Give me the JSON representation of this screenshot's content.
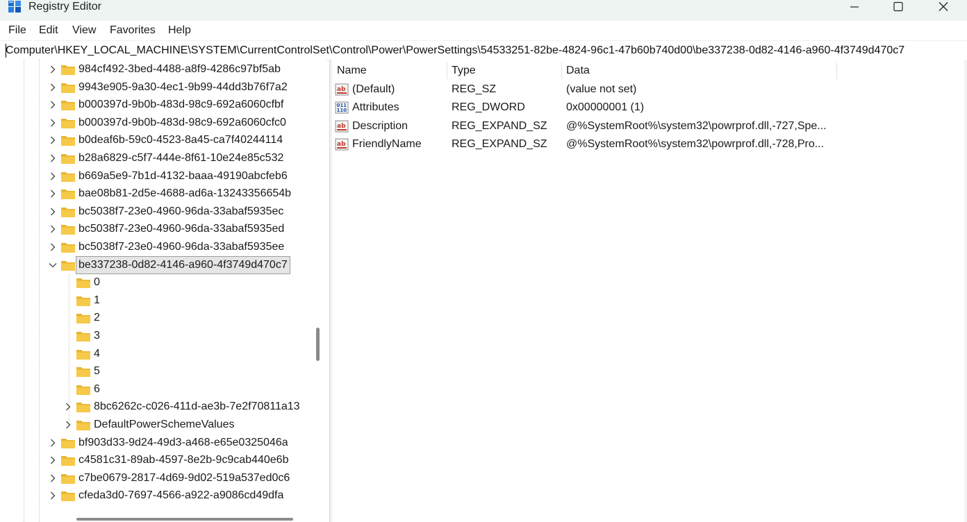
{
  "window": {
    "title": "Registry Editor"
  },
  "menu": [
    "File",
    "Edit",
    "View",
    "Favorites",
    "Help"
  ],
  "address": {
    "path": "Computer\\HKEY_LOCAL_MACHINE\\SYSTEM\\CurrentControlSet\\Control\\Power\\PowerSettings\\54533251-82be-4824-96c1-47b60b740d00\\be337238-0d82-4146-a960-4f3749d470c7"
  },
  "tree": {
    "items": [
      {
        "label": "984cf492-3bed-4488-a8f9-4286c97bf5ab",
        "level": 1,
        "arrow": "collapsed"
      },
      {
        "label": "9943e905-9a30-4ec1-9b99-44dd3b76f7a2",
        "level": 1,
        "arrow": "collapsed"
      },
      {
        "label": "b000397d-9b0b-483d-98c9-692a6060cfbf",
        "level": 1,
        "arrow": "collapsed"
      },
      {
        "label": "b000397d-9b0b-483d-98c9-692a6060cfc0",
        "level": 1,
        "arrow": "collapsed"
      },
      {
        "label": "b0deaf6b-59c0-4523-8a45-ca7f40244114",
        "level": 1,
        "arrow": "collapsed"
      },
      {
        "label": "b28a6829-c5f7-444e-8f61-10e24e85c532",
        "level": 1,
        "arrow": "collapsed"
      },
      {
        "label": "b669a5e9-7b1d-4132-baaa-49190abcfeb6",
        "level": 1,
        "arrow": "collapsed"
      },
      {
        "label": "bae08b81-2d5e-4688-ad6a-13243356654b",
        "level": 1,
        "arrow": "collapsed"
      },
      {
        "label": "bc5038f7-23e0-4960-96da-33abaf5935ec",
        "level": 1,
        "arrow": "collapsed"
      },
      {
        "label": "bc5038f7-23e0-4960-96da-33abaf5935ed",
        "level": 1,
        "arrow": "collapsed"
      },
      {
        "label": "bc5038f7-23e0-4960-96da-33abaf5935ee",
        "level": 1,
        "arrow": "collapsed"
      },
      {
        "label": "be337238-0d82-4146-a960-4f3749d470c7",
        "level": 1,
        "arrow": "expanded",
        "selected": true
      },
      {
        "label": "0",
        "level": 2,
        "arrow": "none"
      },
      {
        "label": "1",
        "level": 2,
        "arrow": "none"
      },
      {
        "label": "2",
        "level": 2,
        "arrow": "none"
      },
      {
        "label": "3",
        "level": 2,
        "arrow": "none"
      },
      {
        "label": "4",
        "level": 2,
        "arrow": "none"
      },
      {
        "label": "5",
        "level": 2,
        "arrow": "none"
      },
      {
        "label": "6",
        "level": 2,
        "arrow": "none"
      },
      {
        "label": "8bc6262c-c026-411d-ae3b-7e2f70811a13",
        "level": 2,
        "arrow": "collapsed"
      },
      {
        "label": "DefaultPowerSchemeValues",
        "level": 2,
        "arrow": "collapsed"
      },
      {
        "label": "bf903d33-9d24-49d3-a468-e65e0325046a",
        "level": 1,
        "arrow": "collapsed"
      },
      {
        "label": "c4581c31-89ab-4597-8e2b-9c9cab440e6b",
        "level": 1,
        "arrow": "collapsed"
      },
      {
        "label": "c7be0679-2817-4d69-9d02-519a537ed0c6",
        "level": 1,
        "arrow": "collapsed"
      },
      {
        "label": "cfeda3d0-7697-4566-a922-a9086cd49dfa",
        "level": 1,
        "arrow": "collapsed"
      }
    ]
  },
  "list": {
    "headers": {
      "name": "Name",
      "type": "Type",
      "data": "Data"
    },
    "rows": [
      {
        "icon": "string-value-icon",
        "name": "(Default)",
        "type": "REG_SZ",
        "data": "(value not set)"
      },
      {
        "icon": "binary-value-icon",
        "name": "Attributes",
        "type": "REG_DWORD",
        "data": "0x00000001 (1)"
      },
      {
        "icon": "string-value-icon",
        "name": "Description",
        "type": "REG_EXPAND_SZ",
        "data": "@%SystemRoot%\\system32\\powrprof.dll,-727,Spe..."
      },
      {
        "icon": "string-value-icon",
        "name": "FriendlyName",
        "type": "REG_EXPAND_SZ",
        "data": "@%SystemRoot%\\system32\\powrprof.dll,-728,Pro..."
      }
    ]
  },
  "colors": {
    "folder": "#f7c948",
    "selection": "#e5e5e5",
    "titlebar": "#eef4f1"
  }
}
